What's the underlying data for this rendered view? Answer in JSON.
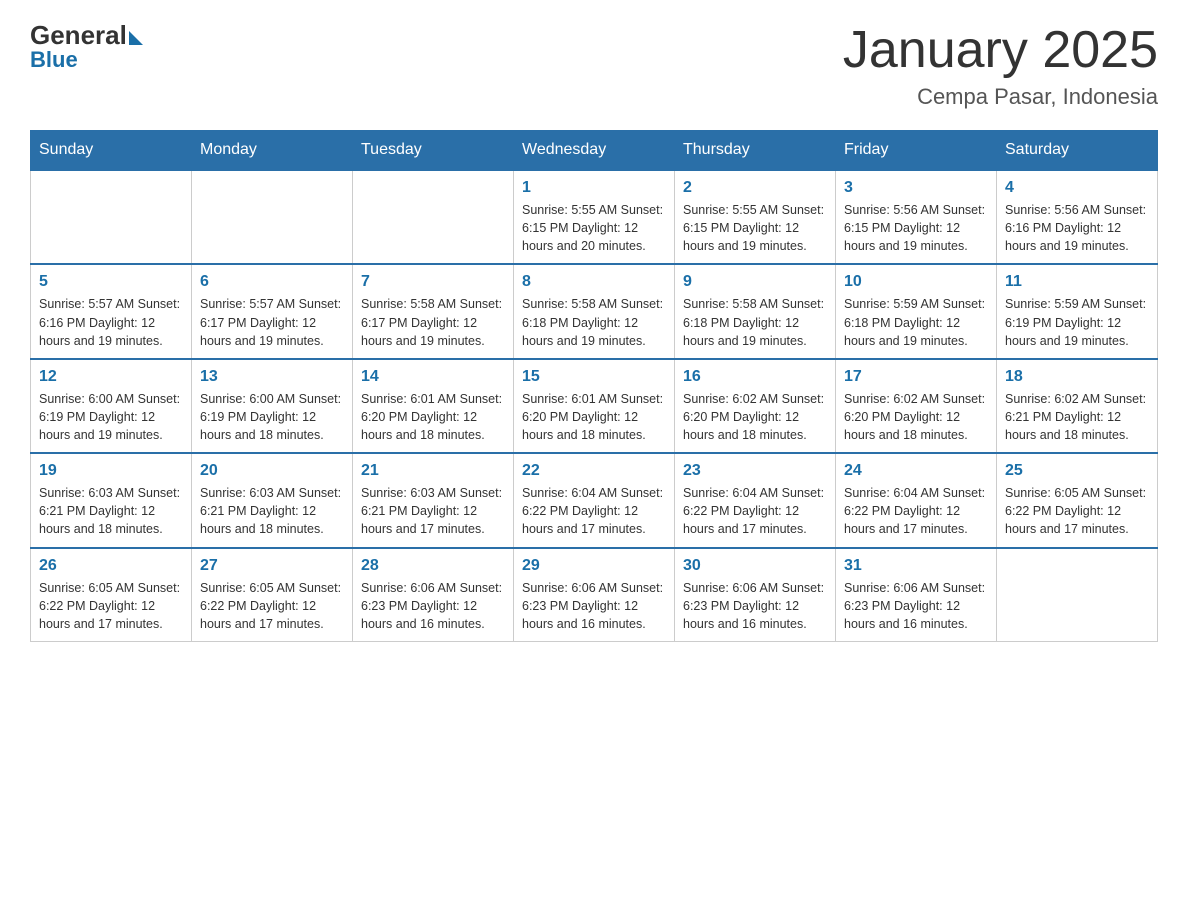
{
  "logo": {
    "general": "General",
    "blue": "Blue",
    "subtitle": "Blue"
  },
  "title": "January 2025",
  "location": "Cempa Pasar, Indonesia",
  "days_of_week": [
    "Sunday",
    "Monday",
    "Tuesday",
    "Wednesday",
    "Thursday",
    "Friday",
    "Saturday"
  ],
  "weeks": [
    [
      {
        "day": "",
        "info": ""
      },
      {
        "day": "",
        "info": ""
      },
      {
        "day": "",
        "info": ""
      },
      {
        "day": "1",
        "info": "Sunrise: 5:55 AM\nSunset: 6:15 PM\nDaylight: 12 hours\nand 20 minutes."
      },
      {
        "day": "2",
        "info": "Sunrise: 5:55 AM\nSunset: 6:15 PM\nDaylight: 12 hours\nand 19 minutes."
      },
      {
        "day": "3",
        "info": "Sunrise: 5:56 AM\nSunset: 6:15 PM\nDaylight: 12 hours\nand 19 minutes."
      },
      {
        "day": "4",
        "info": "Sunrise: 5:56 AM\nSunset: 6:16 PM\nDaylight: 12 hours\nand 19 minutes."
      }
    ],
    [
      {
        "day": "5",
        "info": "Sunrise: 5:57 AM\nSunset: 6:16 PM\nDaylight: 12 hours\nand 19 minutes."
      },
      {
        "day": "6",
        "info": "Sunrise: 5:57 AM\nSunset: 6:17 PM\nDaylight: 12 hours\nand 19 minutes."
      },
      {
        "day": "7",
        "info": "Sunrise: 5:58 AM\nSunset: 6:17 PM\nDaylight: 12 hours\nand 19 minutes."
      },
      {
        "day": "8",
        "info": "Sunrise: 5:58 AM\nSunset: 6:18 PM\nDaylight: 12 hours\nand 19 minutes."
      },
      {
        "day": "9",
        "info": "Sunrise: 5:58 AM\nSunset: 6:18 PM\nDaylight: 12 hours\nand 19 minutes."
      },
      {
        "day": "10",
        "info": "Sunrise: 5:59 AM\nSunset: 6:18 PM\nDaylight: 12 hours\nand 19 minutes."
      },
      {
        "day": "11",
        "info": "Sunrise: 5:59 AM\nSunset: 6:19 PM\nDaylight: 12 hours\nand 19 minutes."
      }
    ],
    [
      {
        "day": "12",
        "info": "Sunrise: 6:00 AM\nSunset: 6:19 PM\nDaylight: 12 hours\nand 19 minutes."
      },
      {
        "day": "13",
        "info": "Sunrise: 6:00 AM\nSunset: 6:19 PM\nDaylight: 12 hours\nand 18 minutes."
      },
      {
        "day": "14",
        "info": "Sunrise: 6:01 AM\nSunset: 6:20 PM\nDaylight: 12 hours\nand 18 minutes."
      },
      {
        "day": "15",
        "info": "Sunrise: 6:01 AM\nSunset: 6:20 PM\nDaylight: 12 hours\nand 18 minutes."
      },
      {
        "day": "16",
        "info": "Sunrise: 6:02 AM\nSunset: 6:20 PM\nDaylight: 12 hours\nand 18 minutes."
      },
      {
        "day": "17",
        "info": "Sunrise: 6:02 AM\nSunset: 6:20 PM\nDaylight: 12 hours\nand 18 minutes."
      },
      {
        "day": "18",
        "info": "Sunrise: 6:02 AM\nSunset: 6:21 PM\nDaylight: 12 hours\nand 18 minutes."
      }
    ],
    [
      {
        "day": "19",
        "info": "Sunrise: 6:03 AM\nSunset: 6:21 PM\nDaylight: 12 hours\nand 18 minutes."
      },
      {
        "day": "20",
        "info": "Sunrise: 6:03 AM\nSunset: 6:21 PM\nDaylight: 12 hours\nand 18 minutes."
      },
      {
        "day": "21",
        "info": "Sunrise: 6:03 AM\nSunset: 6:21 PM\nDaylight: 12 hours\nand 17 minutes."
      },
      {
        "day": "22",
        "info": "Sunrise: 6:04 AM\nSunset: 6:22 PM\nDaylight: 12 hours\nand 17 minutes."
      },
      {
        "day": "23",
        "info": "Sunrise: 6:04 AM\nSunset: 6:22 PM\nDaylight: 12 hours\nand 17 minutes."
      },
      {
        "day": "24",
        "info": "Sunrise: 6:04 AM\nSunset: 6:22 PM\nDaylight: 12 hours\nand 17 minutes."
      },
      {
        "day": "25",
        "info": "Sunrise: 6:05 AM\nSunset: 6:22 PM\nDaylight: 12 hours\nand 17 minutes."
      }
    ],
    [
      {
        "day": "26",
        "info": "Sunrise: 6:05 AM\nSunset: 6:22 PM\nDaylight: 12 hours\nand 17 minutes."
      },
      {
        "day": "27",
        "info": "Sunrise: 6:05 AM\nSunset: 6:22 PM\nDaylight: 12 hours\nand 17 minutes."
      },
      {
        "day": "28",
        "info": "Sunrise: 6:06 AM\nSunset: 6:23 PM\nDaylight: 12 hours\nand 16 minutes."
      },
      {
        "day": "29",
        "info": "Sunrise: 6:06 AM\nSunset: 6:23 PM\nDaylight: 12 hours\nand 16 minutes."
      },
      {
        "day": "30",
        "info": "Sunrise: 6:06 AM\nSunset: 6:23 PM\nDaylight: 12 hours\nand 16 minutes."
      },
      {
        "day": "31",
        "info": "Sunrise: 6:06 AM\nSunset: 6:23 PM\nDaylight: 12 hours\nand 16 minutes."
      },
      {
        "day": "",
        "info": ""
      }
    ]
  ]
}
